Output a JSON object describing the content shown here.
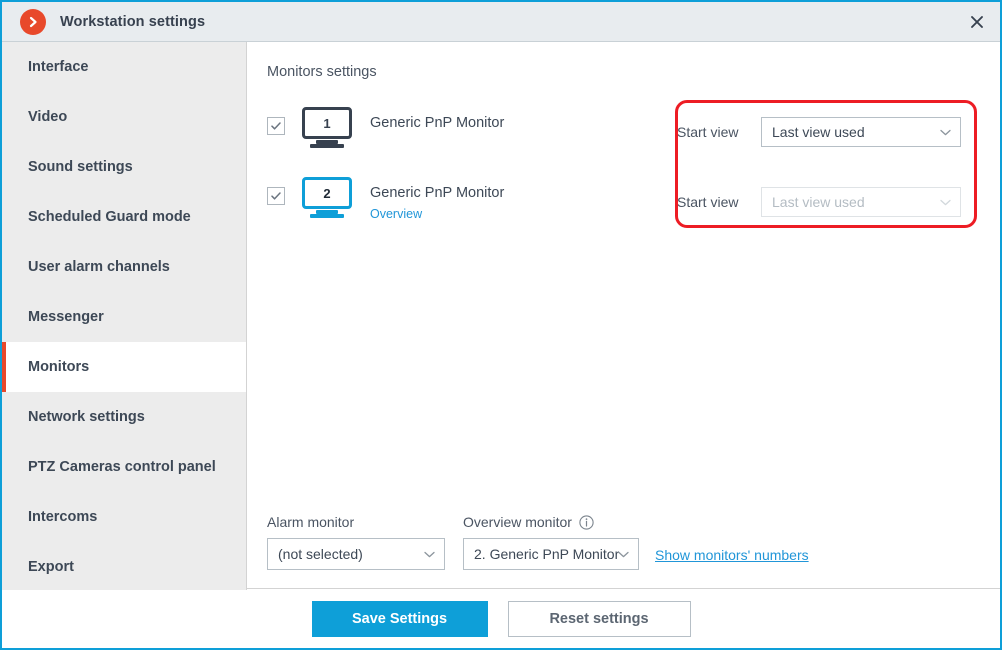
{
  "window": {
    "title": "Workstation settings",
    "logo_icon": "chevron-right-circle-icon",
    "close_icon": "close-icon",
    "accent_color": "#0e9fd8",
    "brand_color": "#e8492b"
  },
  "sidebar": {
    "items": [
      {
        "label": "Interface",
        "active": false
      },
      {
        "label": "Video",
        "active": false
      },
      {
        "label": "Sound settings",
        "active": false
      },
      {
        "label": "Scheduled Guard mode",
        "active": false
      },
      {
        "label": "User alarm channels",
        "active": false
      },
      {
        "label": "Messenger",
        "active": false
      },
      {
        "label": "Monitors",
        "active": true
      },
      {
        "label": "Network settings",
        "active": false
      },
      {
        "label": "PTZ Cameras control panel",
        "active": false
      },
      {
        "label": "Intercoms",
        "active": false
      },
      {
        "label": "Export",
        "active": false
      }
    ]
  },
  "content": {
    "heading": "Monitors settings",
    "monitors": [
      {
        "number": "1",
        "name": "Generic PnP Monitor",
        "sublabel": "",
        "checked": true,
        "accent": false,
        "start_view_label": "Start view",
        "start_view_value": "Last view used",
        "start_view_disabled": false
      },
      {
        "number": "2",
        "name": "Generic PnP Monitor",
        "sublabel": "Overview",
        "checked": true,
        "accent": true,
        "start_view_label": "Start view",
        "start_view_value": "Last view used",
        "start_view_disabled": true
      }
    ],
    "alarm_monitor": {
      "label": "Alarm monitor",
      "value": "(not selected)"
    },
    "overview_monitor": {
      "label": "Overview monitor",
      "info_icon": "info-icon",
      "value": "2. Generic PnP Monitor"
    },
    "show_numbers_link": "Show monitors' numbers"
  },
  "footer": {
    "save_label": "Save Settings",
    "reset_label": "Reset settings"
  },
  "annotation": {
    "shape": "rounded-rectangle",
    "color": "#ed1c24"
  }
}
